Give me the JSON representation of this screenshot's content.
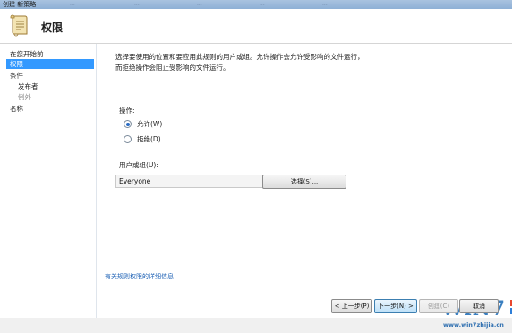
{
  "window": {
    "title": "创建 新策略",
    "ghost_tabs": [
      "...",
      "...",
      "...",
      "...",
      "..."
    ]
  },
  "header": {
    "title": "权限",
    "icon": "scroll-document-icon"
  },
  "sidebar": {
    "items": [
      {
        "label": "在您开始前",
        "state": "normal"
      },
      {
        "label": "权限",
        "state": "selected"
      },
      {
        "label": "条件",
        "state": "normal"
      },
      {
        "label": "发布者",
        "state": "normal"
      },
      {
        "label": "例外",
        "state": "disabled"
      },
      {
        "label": "名称",
        "state": "normal"
      }
    ]
  },
  "main": {
    "description": "选择要使用的位置和要应用此规则的用户或组。允许操作会允许受影响的文件运行，而拒绝操作会阻止受影响的文件运行。",
    "action_label": "操作:",
    "allow_label": "允许(W)",
    "deny_label": "拒绝(D)",
    "action_selected": "allow",
    "user_group_label": "用户或组(U):",
    "user_group_value": "Everyone",
    "select_button": "选择(S)...",
    "more_info_link": "有关规则权限的详细信息"
  },
  "footer": {
    "back": "< 上一步(P)",
    "next": "下一步(N) >",
    "create": "创建(C)",
    "cancel": "取消"
  },
  "watermark": {
    "brand": "WiN7",
    "suffix": "家",
    "url": "www.win7zhijia.cn"
  },
  "colors": {
    "selection": "#3399ff",
    "link": "#1a5fb4",
    "watermark": "#3a7fc0"
  }
}
